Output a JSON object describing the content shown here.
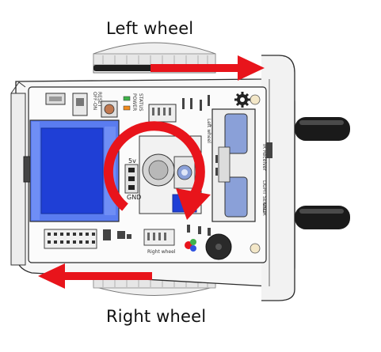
{
  "captions": {
    "left_wheel": "Left wheel",
    "right_wheel": "Right wheel"
  },
  "pcb_labels": {
    "off_on": "OFF-ON",
    "reset": "RESET",
    "power": "POWER",
    "status": "STATUS",
    "five_v": "5v",
    "gnd": "GND",
    "right_wheel_port": "Right wheel",
    "ir_receiver": "IR Receiver",
    "light_sensor": "LIGHT SENSOR",
    "gnd_side": "GND",
    "left_wheel_port": "Left wheel"
  },
  "colors": {
    "arrow_red": "#e8141b",
    "display_blue": "#1f3fd6",
    "display_frame": "#5a7cf0",
    "board_white": "#f4f4f4",
    "outline": "#2a2a2a",
    "tire": "#1a1a1a",
    "sensor_blue": "#8aa0d8"
  },
  "icons": {
    "rotation": "clockwise-rotation-arrow-icon",
    "move_forward": "right-arrow-icon",
    "move_backward": "left-arrow-icon",
    "gear": "gear-icon"
  }
}
